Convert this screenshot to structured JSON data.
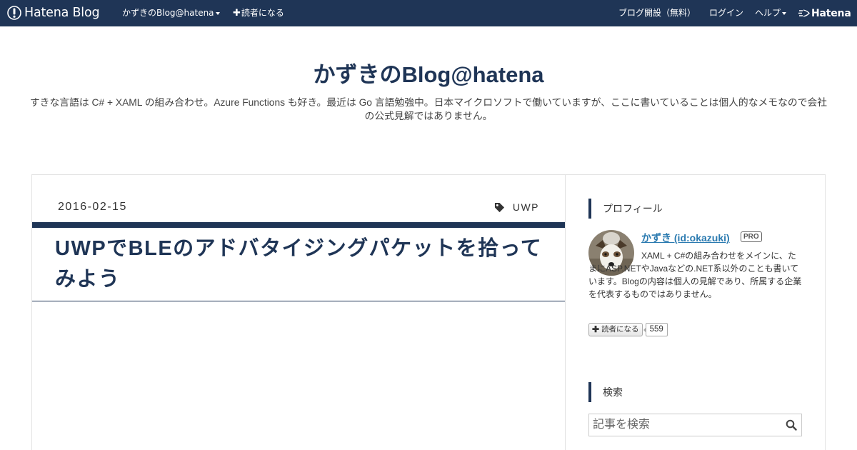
{
  "navbar": {
    "brand": "Hatena Blog",
    "blog_menu": "かずきのBlog@hatena",
    "subscribe": "読者になる",
    "open_blog": "ブログ開設（無料）",
    "login": "ログイン",
    "help": "ヘルプ",
    "hatena": "Hatena"
  },
  "header": {
    "title": "かずきのBlog@hatena",
    "description": "すきな言語は C# + XAML の組み合わせ。Azure Functions も好き。最近は Go 言語勉強中。日本マイクロソフトで働いていますが、ここに書いていることは個人的なメモなので会社の公式見解ではありません。"
  },
  "entry": {
    "date": "2016-02-15",
    "category": "UWP",
    "title": "UWPでBLEのアドバタイジングパケットを拾ってみよう"
  },
  "sidebar": {
    "profile": {
      "heading": "プロフィール",
      "name": "かずき (id:okazuki)",
      "badge": "PRO",
      "description": "XAML + C#の組み合わせをメインに、たまにASP.NETやJavaなどの.NET系以外のことも書いています。Blogの内容は個人の見解であり、所属する企業を代表するものではありません。",
      "subscribe_label": "読者になる",
      "subscriber_count": "559"
    },
    "search": {
      "heading": "検索",
      "placeholder": "記事を検索"
    }
  },
  "colors": {
    "navbar_bg": "#1f3556",
    "accent": "#1f3556",
    "link": "#2a7ab0"
  }
}
